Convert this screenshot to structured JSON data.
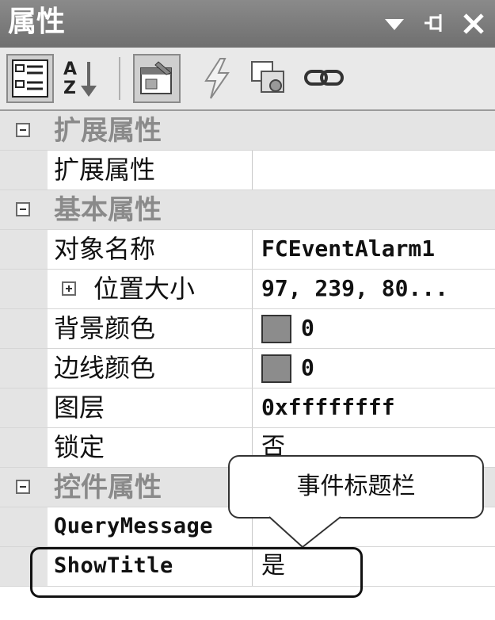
{
  "window": {
    "title": "属性",
    "controls": [
      "dropdown-arrow-icon",
      "pin-icon",
      "close-icon"
    ]
  },
  "toolbar": {
    "buttons": [
      {
        "icon": "categorized-icon"
      },
      {
        "icon": "alphabetical-sort-icon",
        "label": "AZ"
      },
      {
        "icon": "properties-icon",
        "active": true
      },
      {
        "icon": "events-lightning-icon"
      },
      {
        "icon": "property-pages-icon"
      },
      {
        "icon": "link-icon"
      }
    ]
  },
  "grid": {
    "categories": [
      {
        "label": "扩展属性",
        "rows": [
          {
            "name": "扩展属性",
            "value": ""
          }
        ]
      },
      {
        "label": "基本属性",
        "rows": [
          {
            "name": "对象名称",
            "value": "FCEventAlarm1"
          },
          {
            "name": "位置大小",
            "value": "97, 239, 80..."
          },
          {
            "name": "背景颜色",
            "value": "0",
            "swatch": "#8c8c8c"
          },
          {
            "name": "边线颜色",
            "value": "0",
            "swatch": "#8c8c8c"
          },
          {
            "name": "图层",
            "value": "0xffffffff"
          },
          {
            "name": "锁定",
            "value": "否"
          }
        ]
      },
      {
        "label": "控件属性",
        "rows": [
          {
            "name": "QueryMessage",
            "value": ""
          },
          {
            "name": "ShowTitle",
            "value": "是"
          }
        ]
      }
    ]
  },
  "callout": {
    "text": "事件标题栏"
  }
}
